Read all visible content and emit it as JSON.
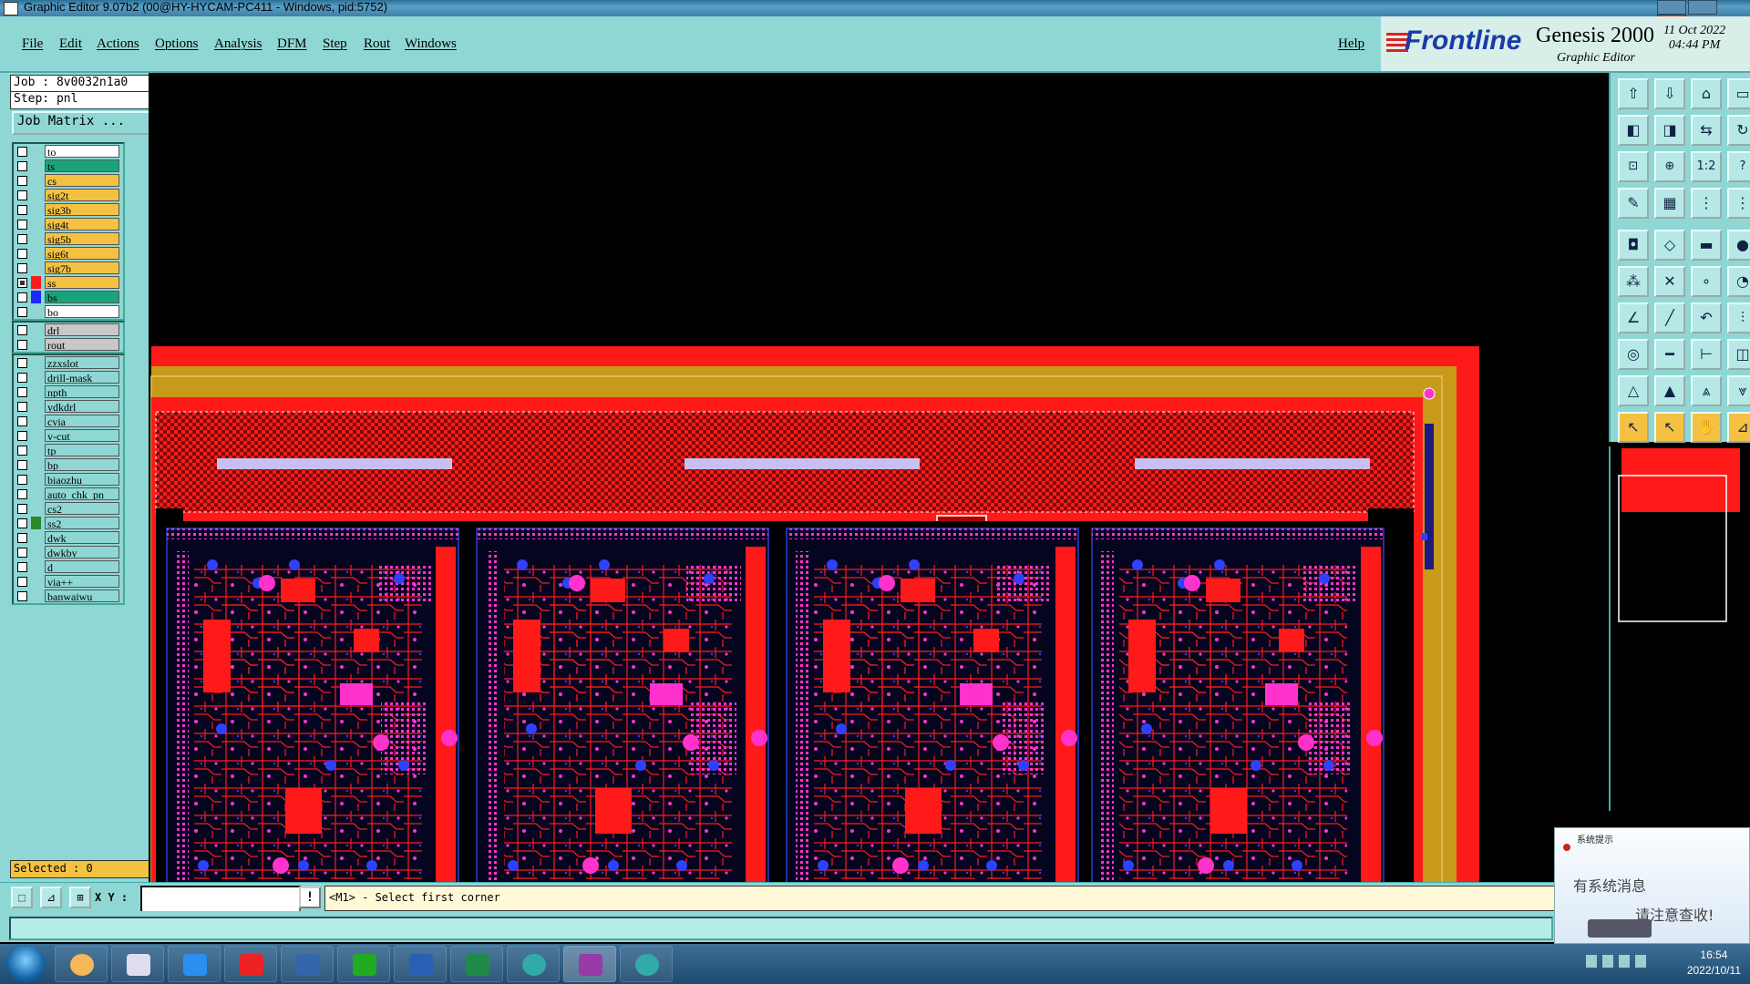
{
  "window": {
    "title": "Graphic Editor 9.07b2 (00@HY-HYCAM-PC411 - Windows, pid:5752)"
  },
  "menu": {
    "items": [
      "File",
      "Edit",
      "Actions",
      "Options",
      "Analysis",
      "DFM",
      "Step",
      "Rout",
      "Windows"
    ],
    "help": "Help"
  },
  "brand": {
    "logo": "Frontline",
    "product": "Genesis 2000",
    "subtitle": "Graphic Editor",
    "date": "11 Oct 2022",
    "time": "04:44 PM"
  },
  "job": {
    "job_label": "Job : 8v0032n1a0",
    "step_label": "Step: pnl",
    "matrix_button": "Job Matrix ..."
  },
  "layers": {
    "group1": [
      {
        "name": "to",
        "bg": "#ffffff",
        "swatch": "",
        "checked": false
      },
      {
        "name": "ts",
        "bg": "#1aa37a",
        "swatch": "",
        "checked": false
      },
      {
        "name": "cs",
        "bg": "#f5c142",
        "swatch": "",
        "checked": false
      },
      {
        "name": "sig2t",
        "bg": "#f5c142",
        "swatch": "",
        "checked": false
      },
      {
        "name": "sig3b",
        "bg": "#f5c142",
        "swatch": "",
        "checked": false
      },
      {
        "name": "sig4t",
        "bg": "#f5c142",
        "swatch": "",
        "checked": false
      },
      {
        "name": "sig5b",
        "bg": "#f5c142",
        "swatch": "",
        "checked": false
      },
      {
        "name": "sig6t",
        "bg": "#f5c142",
        "swatch": "",
        "checked": false
      },
      {
        "name": "sig7b",
        "bg": "#f5c142",
        "swatch": "",
        "checked": false
      },
      {
        "name": "ss",
        "bg": "#f5c142",
        "swatch": "#ff1a1a",
        "checked": true
      },
      {
        "name": "bs",
        "bg": "#1aa37a",
        "swatch": "#1a2aff",
        "checked": false
      },
      {
        "name": "bo",
        "bg": "#ffffff",
        "swatch": "",
        "checked": false
      }
    ],
    "group2": [
      {
        "name": "drl",
        "bg": "#c8c8c8",
        "swatch": "",
        "checked": false
      },
      {
        "name": "rout",
        "bg": "#c8c8c8",
        "swatch": "",
        "checked": false
      }
    ],
    "group3": [
      {
        "name": "zzxslot",
        "bg": "#8ed7d4",
        "swatch": "",
        "checked": false
      },
      {
        "name": "drill-mask",
        "bg": "#8ed7d4",
        "swatch": "",
        "checked": false
      },
      {
        "name": "npth",
        "bg": "#8ed7d4",
        "swatch": "",
        "checked": false
      },
      {
        "name": "ydkdrl",
        "bg": "#8ed7d4",
        "swatch": "",
        "checked": false
      },
      {
        "name": "cvia",
        "bg": "#8ed7d4",
        "swatch": "",
        "checked": false
      },
      {
        "name": "v-cut",
        "bg": "#8ed7d4",
        "swatch": "",
        "checked": false
      },
      {
        "name": "tp",
        "bg": "#8ed7d4",
        "swatch": "",
        "checked": false
      },
      {
        "name": "bp",
        "bg": "#8ed7d4",
        "swatch": "",
        "checked": false
      },
      {
        "name": "biaozhu",
        "bg": "#8ed7d4",
        "swatch": "",
        "checked": false
      },
      {
        "name": "auto_chk_pn",
        "bg": "#8ed7d4",
        "swatch": "",
        "checked": false
      },
      {
        "name": "cs2",
        "bg": "#8ed7d4",
        "swatch": "",
        "checked": false
      },
      {
        "name": "ss2",
        "bg": "#8ed7d4",
        "swatch": "#2a8a2a",
        "checked": false
      },
      {
        "name": "dwk",
        "bg": "#8ed7d4",
        "swatch": "",
        "checked": false
      },
      {
        "name": "dwkby",
        "bg": "#8ed7d4",
        "swatch": "",
        "checked": false
      },
      {
        "name": "d",
        "bg": "#8ed7d4",
        "swatch": "",
        "checked": false
      },
      {
        "name": "via++",
        "bg": "#8ed7d4",
        "swatch": "",
        "checked": false
      },
      {
        "name": "banwaiwu",
        "bg": "#8ed7d4",
        "swatch": "",
        "checked": false
      }
    ]
  },
  "selection": {
    "label": "Selected : 0"
  },
  "command": {
    "xy_label": "X Y :",
    "xy_value": "",
    "prompt": "<M1> - Select first corner",
    "excl": "!"
  },
  "popup": {
    "header": "系统提示",
    "message_line1": "有系统消息",
    "message_line2": "请注意查收!"
  },
  "taskbar": {
    "time": "16:54",
    "date": "2022/10/11"
  },
  "toolbar_icons": [
    "fit-icon",
    "zoom-in-icon",
    "home-icon",
    "window-icon",
    "pan-left-icon",
    "pan-right-icon",
    "mirror-icon",
    "refresh-icon",
    "zoom-box-icon",
    "zoom-fit-icon",
    "ratio-icon",
    "help-icon",
    "snap-icon",
    "grid-icon",
    "layers-icon",
    "layers2-icon",
    "pad-icon",
    "shape-icon",
    "line-icon",
    "dot-icon",
    "net-icon",
    "cross-icon",
    "connect-icon",
    "node-icon",
    "angle-icon",
    "draw-icon",
    "curve-icon",
    "split-icon",
    "target-icon",
    "measure-icon",
    "dim-icon",
    "group-icon",
    "triangle-icon",
    "triangle2-icon",
    "triangle3-icon",
    "triangle4-icon",
    "pointer-icon",
    "pointer2-icon",
    "hand-icon",
    "step-icon"
  ],
  "colors": {
    "panel": "#8ed7d4",
    "board_red": "#ff1a1a",
    "board_gold": "#c89a1a",
    "pad_magenta": "#ff33cc",
    "via_blue": "#1a2aff"
  }
}
